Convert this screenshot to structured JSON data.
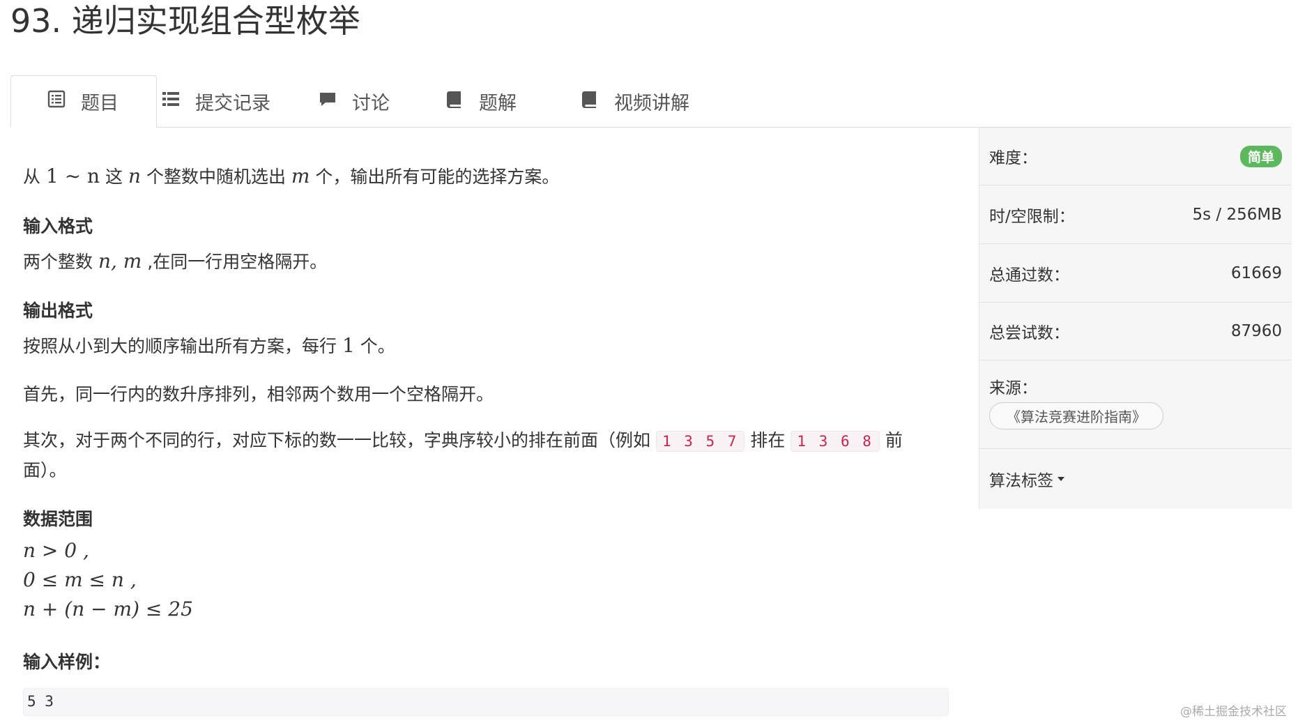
{
  "problem": {
    "title": "93. 递归实现组合型枚举"
  },
  "tabs": [
    {
      "label": "题目",
      "icon": "list-alt-icon",
      "active": true
    },
    {
      "label": "提交记录",
      "icon": "list-icon",
      "active": false
    },
    {
      "label": "讨论",
      "icon": "comment-icon",
      "active": false
    },
    {
      "label": "题解",
      "icon": "book-icon",
      "active": false
    },
    {
      "label": "视频讲解",
      "icon": "book-icon",
      "active": false
    }
  ],
  "content": {
    "intro": {
      "a": "从 ",
      "n1": "1 ∼ n",
      "b": " 这 ",
      "n": "n",
      "c": " 个整数中随机选出 ",
      "m": "m",
      "d": " 个，输出所有可能的选择方案。"
    },
    "input_heading": "输入格式",
    "input_text": {
      "a": "两个整数 ",
      "math": "n, m",
      "b": " ,在同一行用空格隔开。"
    },
    "output_heading": "输出格式",
    "output_text": {
      "a": "按照从小到大的顺序输出所有方案，每行 ",
      "one": "1",
      "b": " 个。"
    },
    "rule1": "首先，同一行内的数升序排列，相邻两个数用一个空格隔开。",
    "rule2": {
      "a": "其次，对于两个不同的行，对应下标的数一一比较，字典序较小的排在前面（例如 ",
      "code1": "1 3 5 7",
      "b": " 排在 ",
      "code2": "1 3 6 8",
      "c": " 前",
      "d": "面）。"
    },
    "range_heading": "数据范围",
    "range_lines": [
      "n > 0 ,",
      "0 ≤ m ≤ n ,",
      "n + (n − m) ≤ 25"
    ],
    "sample_heading": "输入样例：",
    "sample_input": "5 3"
  },
  "sidebar": {
    "difficulty_label": "难度：",
    "difficulty_value": "简单",
    "difficulty_color": "#5cb85c",
    "limit_label": "时/空限制：",
    "limit_value": "5s / 256MB",
    "passed_label": "总通过数：",
    "passed_value": "61669",
    "tried_label": "总尝试数：",
    "tried_value": "87960",
    "source_label": "来源：",
    "source_value": "《算法竞赛进阶指南》",
    "tags_label": "算法标签"
  },
  "watermark": "@稀土掘金技术社区"
}
